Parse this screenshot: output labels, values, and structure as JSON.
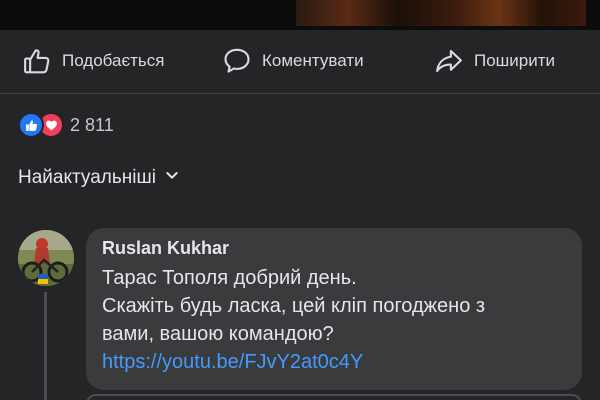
{
  "media": {
    "description_icon": "video-thumbnail"
  },
  "actions": {
    "like_label": "Подобається",
    "comment_label": "Коментувати",
    "share_label": "Поширити",
    "like_icon": "thumbs-up-icon",
    "comment_icon": "speech-bubble-icon",
    "share_icon": "share-arrow-icon"
  },
  "reactions": {
    "count": "2 811",
    "icons": [
      "like-reaction-icon",
      "love-reaction-icon"
    ],
    "colors": {
      "like": "#2078f4",
      "love": "#f33e58"
    }
  },
  "sort": {
    "label": "Найактуальніші",
    "icon": "chevron-down-icon"
  },
  "comment": {
    "author": "Ruslan Kukhar",
    "lines": [
      "Тарас Тополя добрий день.",
      "Скажіть будь ласка, цей кліп погоджено з",
      "вами, вашою командою?"
    ],
    "link": "https://youtu.be/FJvY2at0c4Y"
  },
  "colors": {
    "background": "#242526",
    "bubble": "#3a3b3c",
    "link": "#4599ff",
    "text": "#e4e6eb"
  }
}
